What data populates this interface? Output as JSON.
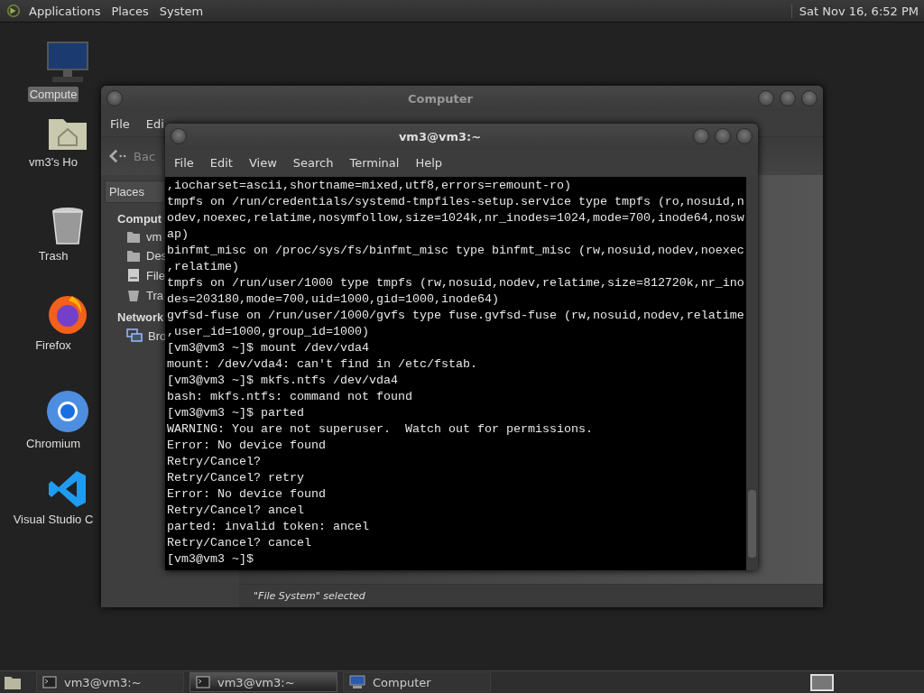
{
  "top_panel": {
    "menus": [
      "Applications",
      "Places",
      "System"
    ],
    "clock": "Sat Nov 16,  6:52 PM"
  },
  "desktop_icons": [
    {
      "label": "Compute",
      "kind": "computer",
      "selected": true
    },
    {
      "label": "vm3's Ho",
      "kind": "home",
      "selected": false
    },
    {
      "label": "Trash",
      "kind": "trash",
      "selected": false
    },
    {
      "label": "Firefox",
      "kind": "firefox",
      "selected": false
    },
    {
      "label": "Chromium",
      "kind": "chromium",
      "selected": false
    },
    {
      "label": "Visual Studio C",
      "kind": "vscode",
      "selected": false
    }
  ],
  "file_manager": {
    "title": "Computer",
    "menus": [
      "File",
      "Edi"
    ],
    "back_button": "Bac",
    "places_dropdown": "Places",
    "sidebar": [
      {
        "heading": "Comput",
        "items": [
          {
            "label": "vm",
            "kind": "home"
          },
          {
            "label": "Des",
            "kind": "folder"
          },
          {
            "label": "File",
            "kind": "drive"
          },
          {
            "label": "Tra",
            "kind": "trash"
          }
        ]
      },
      {
        "heading": "Network",
        "items": [
          {
            "label": "Bro",
            "kind": "network"
          }
        ]
      }
    ],
    "status": "\"File System\" selected"
  },
  "terminal": {
    "title": "vm3@vm3:~",
    "menus": [
      "File",
      "Edit",
      "View",
      "Search",
      "Terminal",
      "Help"
    ],
    "lines": [
      ",iocharset=ascii,shortname=mixed,utf8,errors=remount-ro)",
      "tmpfs on /run/credentials/systemd-tmpfiles-setup.service type tmpfs (ro,nosuid,n",
      "odev,noexec,relatime,nosymfollow,size=1024k,nr_inodes=1024,mode=700,inode64,nosw",
      "ap)",
      "binfmt_misc on /proc/sys/fs/binfmt_misc type binfmt_misc (rw,nosuid,nodev,noexec",
      ",relatime)",
      "tmpfs on /run/user/1000 type tmpfs (rw,nosuid,nodev,relatime,size=812720k,nr_ino",
      "des=203180,mode=700,uid=1000,gid=1000,inode64)",
      "gvfsd-fuse on /run/user/1000/gvfs type fuse.gvfsd-fuse (rw,nosuid,nodev,relatime",
      ",user_id=1000,group_id=1000)",
      "[vm3@vm3 ~]$ mount /dev/vda4",
      "mount: /dev/vda4: can't find in /etc/fstab.",
      "[vm3@vm3 ~]$ mkfs.ntfs /dev/vda4",
      "bash: mkfs.ntfs: command not found",
      "[vm3@vm3 ~]$ parted",
      "WARNING: You are not superuser.  Watch out for permissions.",
      "Error: No device found",
      "Retry/Cancel?",
      "Retry/Cancel? retry",
      "Error: No device found",
      "Retry/Cancel? ancel",
      "parted: invalid token: ancel",
      "Retry/Cancel? cancel",
      "[vm3@vm3 ~]$"
    ]
  },
  "taskbar": {
    "tasks": [
      {
        "label": "vm3@vm3:~",
        "kind": "terminal",
        "selected": false
      },
      {
        "label": "vm3@vm3:~",
        "kind": "terminal",
        "selected": true
      },
      {
        "label": "Computer",
        "kind": "computer",
        "selected": false
      }
    ]
  }
}
